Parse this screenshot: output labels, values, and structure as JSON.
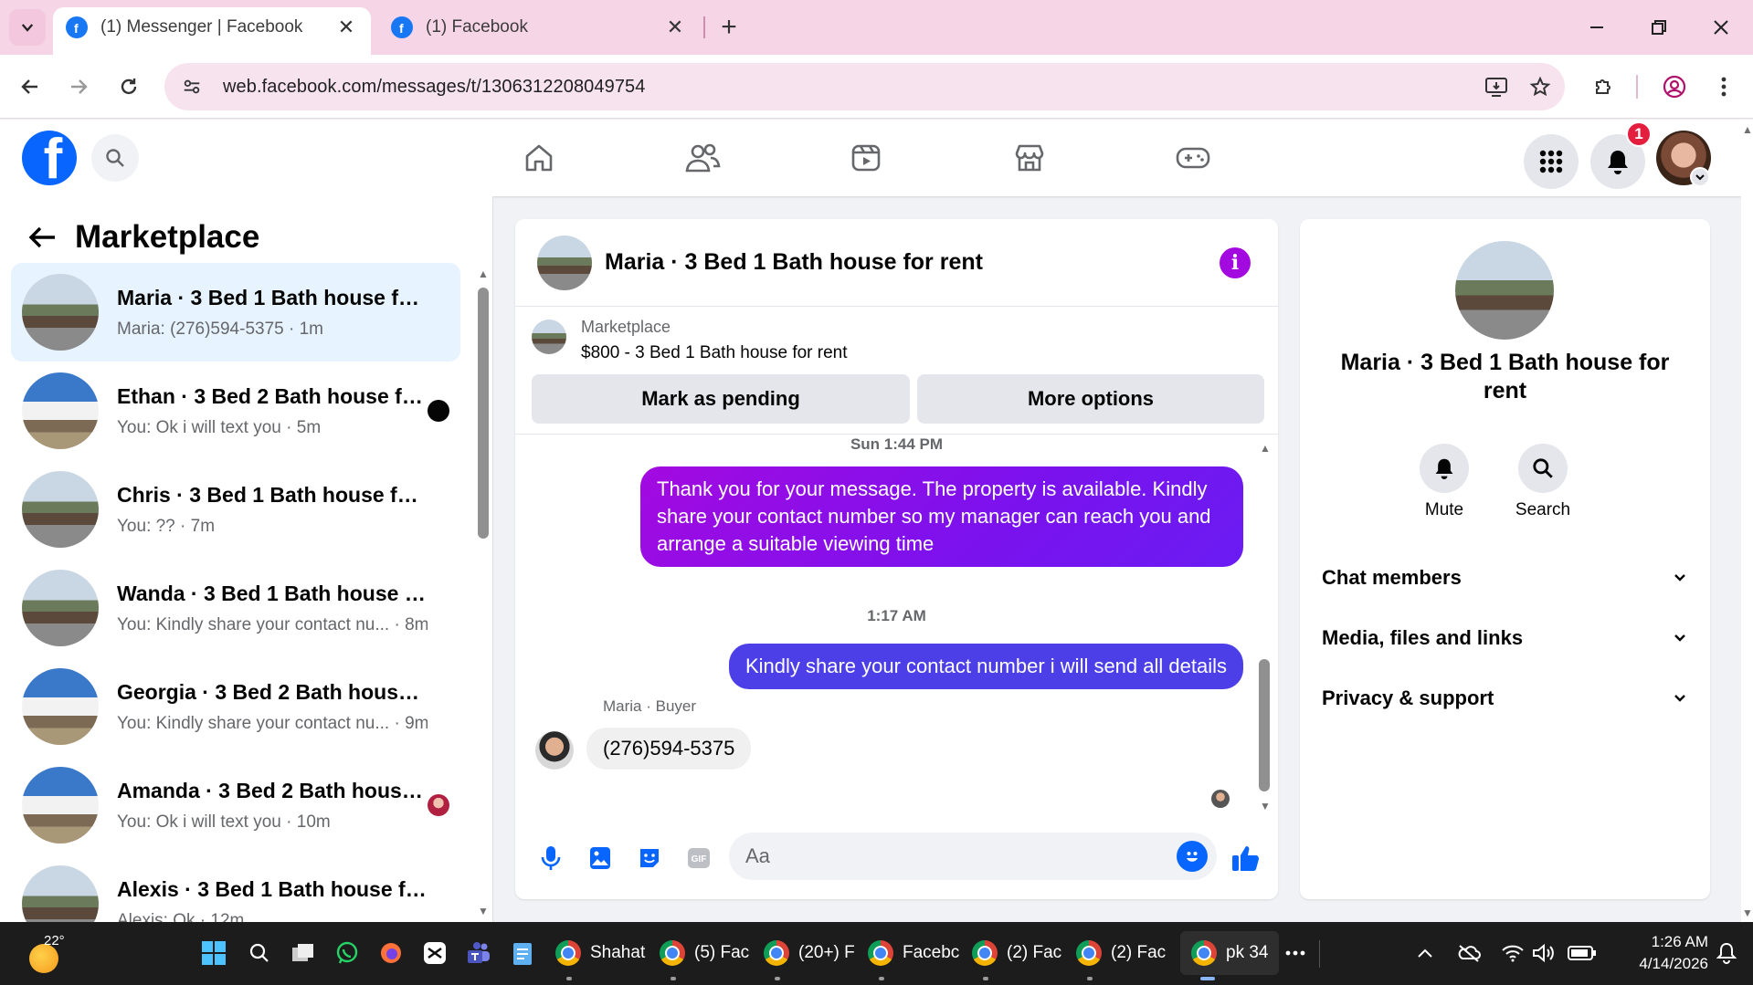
{
  "browser": {
    "tabs": [
      {
        "title": "(1) Messenger | Facebook",
        "active": true
      },
      {
        "title": "(1) Facebook",
        "active": false
      }
    ],
    "url": "web.facebook.com/messages/t/1306312208049754",
    "new_tab": "+"
  },
  "fbnav": {
    "logo": "f",
    "notifications_badge": "1"
  },
  "left_panel": {
    "heading": "Marketplace",
    "conversations": [
      {
        "title": "Maria · 3 Bed 1 Bath house for r...",
        "subtitle": "Maria: (276)594-5375 · 1m",
        "selected": true
      },
      {
        "title": "Ethan · 3 Bed 2 Bath house fo...",
        "subtitle": "You: Ok i will text you · 5m",
        "unread": true
      },
      {
        "title": "Chris · 3 Bed 1 Bath house for rent",
        "subtitle": "You: ?? · 7m"
      },
      {
        "title": "Wanda · 3 Bed 1 Bath house for ...",
        "subtitle": "You: Kindly share your contact nu... · 8m"
      },
      {
        "title": "Georgia · 3 Bed 2 Bath house for...",
        "subtitle": "You: Kindly share your contact nu... · 9m"
      },
      {
        "title": "Amanda · 3 Bed 2 Bath house ...",
        "subtitle": "You: Ok i will text you · 10m"
      },
      {
        "title": "Alexis · 3 Bed 1 Bath house for r...",
        "subtitle": "Alexis: Ok · 12m"
      }
    ]
  },
  "chat": {
    "header_name": "Maria · 3 Bed 1 Bath house for rent",
    "marketplace_label": "Marketplace",
    "listing": "$800 - 3 Bed 1 Bath house for rent",
    "mark_pending": "Mark as pending",
    "more_options": "More options",
    "time_1": "Sun 1:44 PM",
    "msg_out_1": "Thank you for your message. The property is available. Kindly share your contact number so my manager can reach you and arrange a suitable viewing time",
    "time_2": "1:17 AM",
    "msg_out_2": "Kindly share your contact number i will send all details",
    "sender_label": "Maria · Buyer",
    "msg_in_1": "(276)594-5375",
    "composer_placeholder": "Aa"
  },
  "info_panel": {
    "name": "Maria · 3 Bed 1 Bath house for rent",
    "mute": "Mute",
    "search": "Search",
    "rows": [
      "Chat members",
      "Media, files and links",
      "Privacy & support"
    ]
  },
  "taskbar": {
    "temperature": "22°",
    "apps": [
      "Shahat",
      "(5) Fac",
      "(20+) F",
      "Facebc",
      "(2) Fac",
      "(2) Fac",
      "pk 34"
    ],
    "time": "1:26 AM",
    "date": "4/14/2026"
  },
  "colors": {
    "fb_blue": "#0866ff",
    "outgoing_bubble": "#7a12ee",
    "selected_row": "#e7f3ff"
  }
}
